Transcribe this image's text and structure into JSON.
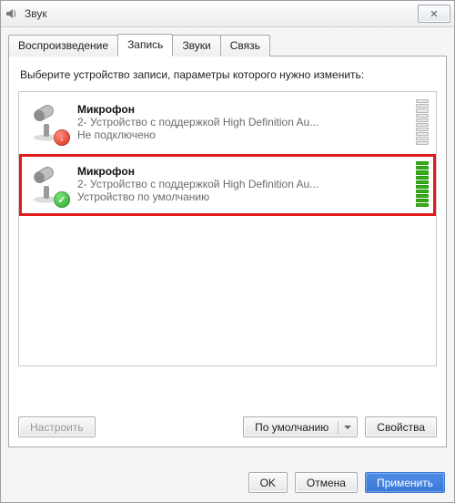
{
  "window": {
    "title": "Звук"
  },
  "tabs": [
    {
      "label": "Воспроизведение",
      "active": false
    },
    {
      "label": "Запись",
      "active": true
    },
    {
      "label": "Звуки",
      "active": false
    },
    {
      "label": "Связь",
      "active": false
    }
  ],
  "instruction": "Выберите устройство записи, параметры которого нужно изменить:",
  "devices": [
    {
      "name": "Микрофон",
      "description": "2- Устройство с поддержкой High Definition Au...",
      "status": "Не подключено",
      "state": "disconnected",
      "selected": false,
      "level": 0
    },
    {
      "name": "Микрофон",
      "description": "2- Устройство с поддержкой High Definition Au...",
      "status": "Устройство по умолчанию",
      "state": "default",
      "selected": true,
      "level": 10
    }
  ],
  "tabButtons": {
    "configure": "Настроить",
    "setDefault": "По умолчанию",
    "properties": "Свойства"
  },
  "dialogButtons": {
    "ok": "OK",
    "cancel": "Отмена",
    "apply": "Применить"
  },
  "icons": {
    "title": "speaker-icon",
    "close": "close-icon",
    "mic": "microphone-icon",
    "disconnected_glyph": "↓",
    "ok_glyph": "✓"
  }
}
